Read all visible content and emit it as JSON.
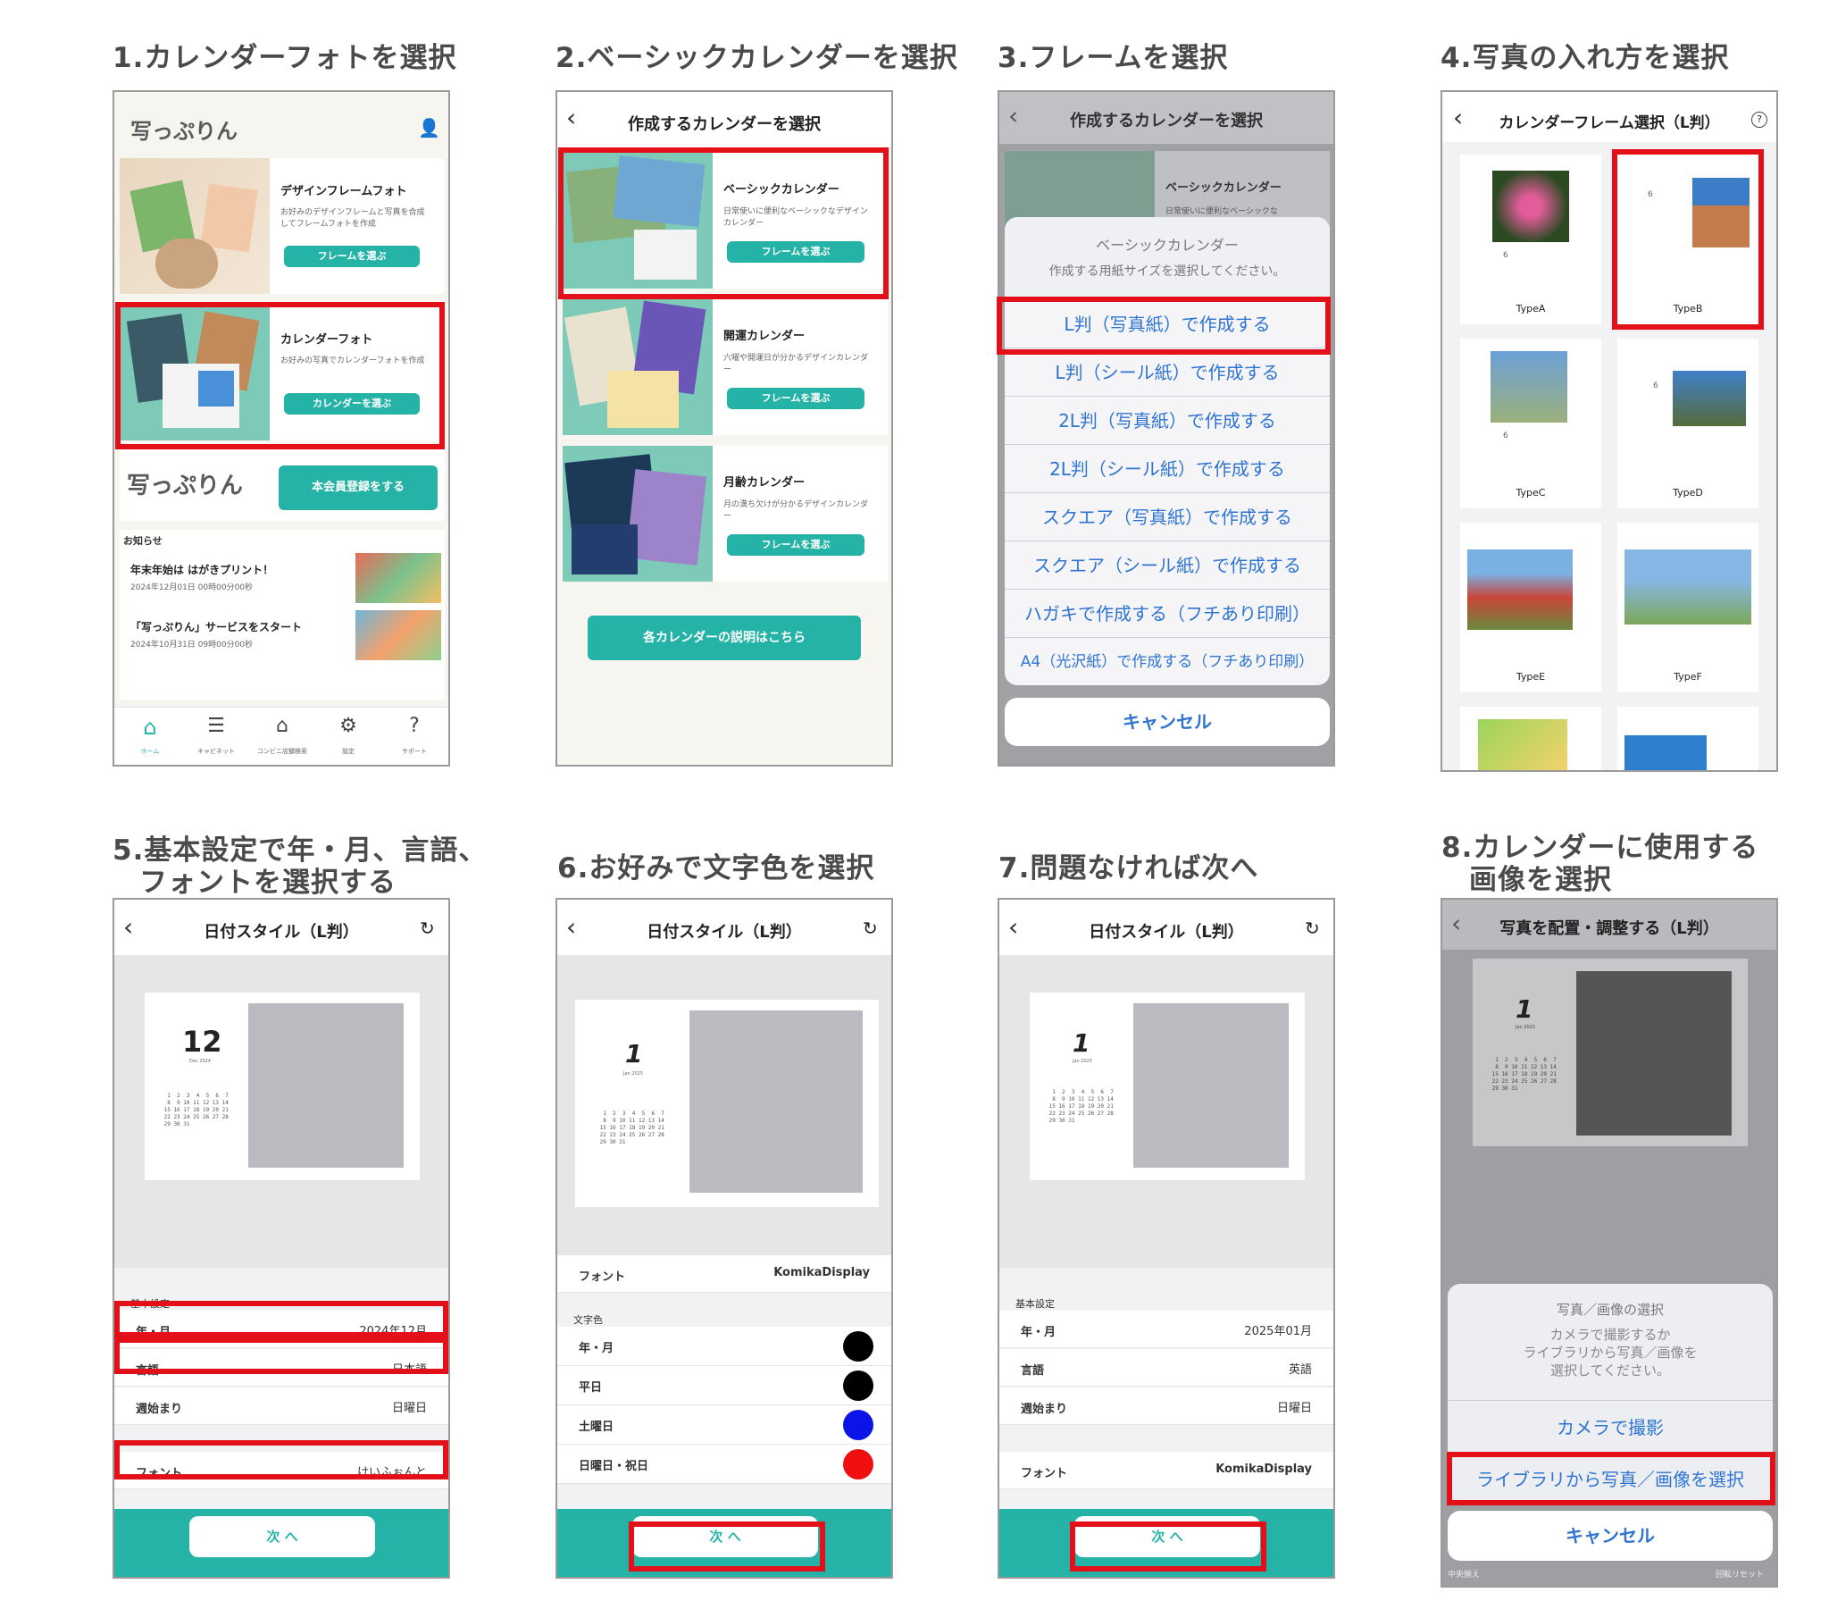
{
  "steps": [
    "1.カレンダーフォトを選択",
    "2.ベーシックカレンダーを選択",
    "3.フレームを選択",
    "4.写真の入れ方を選択",
    "5.基本設定で年・月、言語、",
    "フォントを選択する",
    "6.お好みで文字色を選択",
    "7.問題なければ次へ",
    "8.カレンダーに使用する",
    "画像を選択"
  ],
  "p1": {
    "design_title": "デザインフレームフォト",
    "design_desc": "お好みのデザインフレームと写真を合成してフレームフォトを作成",
    "frame_btn": "フレームを選ぶ",
    "cal_title": "カレンダーフォト",
    "cal_desc": "お好みの写真でカレンダーフォトを作成",
    "cal_btn": "カレンダーを選ぶ",
    "register_btn": "本会員登録をする",
    "news_label": "お知らせ",
    "news": [
      {
        "title": "年末年始は はがきプリント！",
        "date": "2024年12月01日 00時00分00秒"
      },
      {
        "title": "「写っぷりん」サービスをスタート",
        "date": "2024年10月31日 09時00分00秒"
      }
    ],
    "tabs": [
      "ホーム",
      "キャビネット",
      "コンビニ店舗検索",
      "設定",
      "サポート"
    ]
  },
  "p2": {
    "header": "作成するカレンダーを選択",
    "items": [
      {
        "title": "ベーシックカレンダー",
        "desc": "日常使いに便利なベーシックなデザインカレンダー",
        "btn": "フレームを選ぶ"
      },
      {
        "title": "開運カレンダー",
        "desc": "六曜や開運日が分かるデザインカレンダー",
        "btn": "フレームを選ぶ"
      },
      {
        "title": "月齢カレンダー",
        "desc": "月の満ち欠けが分かるデザインカレンダー",
        "btn": "フレームを選ぶ"
      }
    ],
    "explain_btn": "各カレンダーの説明はこちら"
  },
  "p3": {
    "header": "作成するカレンダーを選択",
    "item_title": "ベーシックカレンダー",
    "item_desc": "日常使いに便利なベーシックな",
    "sheet_title": "ベーシックカレンダー",
    "sheet_sub": "作成する用紙サイズを選択してください。",
    "options": [
      "L判（写真紙）で作成する",
      "L判（シール紙）で作成する",
      "2L判（写真紙）で作成する",
      "2L判（シール紙）で作成する",
      "スクエア（写真紙）で作成する",
      "スクエア（シール紙）で作成する",
      "ハガキで作成する（フチあり印刷）",
      "A4（光沢紙）で作成する（フチあり印刷）"
    ],
    "cancel": "キャンセル"
  },
  "p4": {
    "header": "カレンダーフレーム選択（L判）",
    "types": [
      "TypeA",
      "TypeB",
      "TypeC",
      "TypeD",
      "TypeE",
      "TypeF"
    ],
    "month": "6"
  },
  "p5": {
    "header": "日付スタイル（L判）",
    "day": "12",
    "sub": "Dec 2024",
    "section": "基本設定",
    "rows": [
      {
        "label": "年・月",
        "value": "2024年12月"
      },
      {
        "label": "言語",
        "value": "日本語"
      },
      {
        "label": "週始まり",
        "value": "日曜日"
      },
      {
        "label": "フォント",
        "value": "けいふぉんと"
      }
    ],
    "next": "次 へ"
  },
  "p6": {
    "header": "日付スタイル（L判）",
    "day": "1",
    "sub": "Jan 2025",
    "font_label": "フォント",
    "font_value": "KomikaDisplay",
    "color_section": "文字色",
    "colors": [
      {
        "label": "年・月",
        "color": "#000000"
      },
      {
        "label": "平日",
        "color": "#000000"
      },
      {
        "label": "土曜日",
        "color": "#0a14e8"
      },
      {
        "label": "日曜日・祝日",
        "color": "#f00f0f"
      }
    ],
    "next": "次 へ"
  },
  "p7": {
    "header": "日付スタイル（L判）",
    "day": "1",
    "sub": "Jan 2025",
    "section": "基本設定",
    "rows": [
      {
        "label": "年・月",
        "value": "2025年01月"
      },
      {
        "label": "言語",
        "value": "英語"
      },
      {
        "label": "週始まり",
        "value": "日曜日"
      },
      {
        "label": "フォント",
        "value": "KomikaDisplay"
      }
    ],
    "next": "次 へ"
  },
  "p8": {
    "header": "写真を配置・調整する（L判）",
    "day": "1",
    "sub": "Jan 2025",
    "sheet_title": "写真／画像の選択",
    "sheet_msg": "カメラで撮影するか\nライブラリから写真／画像を\n選択してください。",
    "camera": "カメラで撮影",
    "library": "ライブラリから写真／画像を選択",
    "cancel": "キャンセル",
    "bottom_left": "中央揃え",
    "bottom_right": "回転リセット"
  },
  "cal_grid": "  1  2  3  4  5  6  7\n  8  9 10 11 12 13 14\n 15 16 17 18 19 20 21\n 22 23 24 25 26 27 28\n 29 30 31"
}
